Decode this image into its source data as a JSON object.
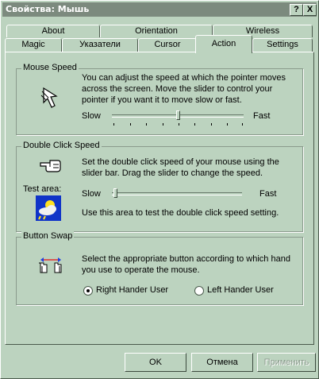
{
  "window": {
    "title": "Свойства: Мышь",
    "help": "?",
    "close": "X"
  },
  "tabs_back": [
    "About",
    "Orientation",
    "Wireless"
  ],
  "tabs_front": [
    "Magic",
    "Указатели",
    "Cursor",
    "Action",
    "Settings"
  ],
  "active_tab": "Action",
  "mouse_speed": {
    "title": "Mouse Speed",
    "desc": [
      "You can adjust the speed at which the pointer moves",
      "across the screen. Move the slider to control your",
      "pointer if you want it to move slow or fast."
    ],
    "slow": "Slow",
    "fast": "Fast",
    "value": 0.5
  },
  "double_click": {
    "title": "Double Click Speed",
    "desc": [
      "Set the double click speed of your mouse using the",
      "slider bar. Drag the slider to change the speed."
    ],
    "test_area": "Test area:",
    "slow": "Slow",
    "fast": "Fast",
    "value": 0.0,
    "test_text": "Use this area to test the double click speed setting."
  },
  "button_swap": {
    "title": "Button Swap",
    "desc": [
      "Select the appropriate button according to which hand",
      "you use to operate the mouse."
    ],
    "right": "Right Hander User",
    "left": "Left Hander User",
    "selected": "right"
  },
  "buttons": {
    "ok": "OK",
    "cancel": "Отмена",
    "apply": "Применить"
  }
}
